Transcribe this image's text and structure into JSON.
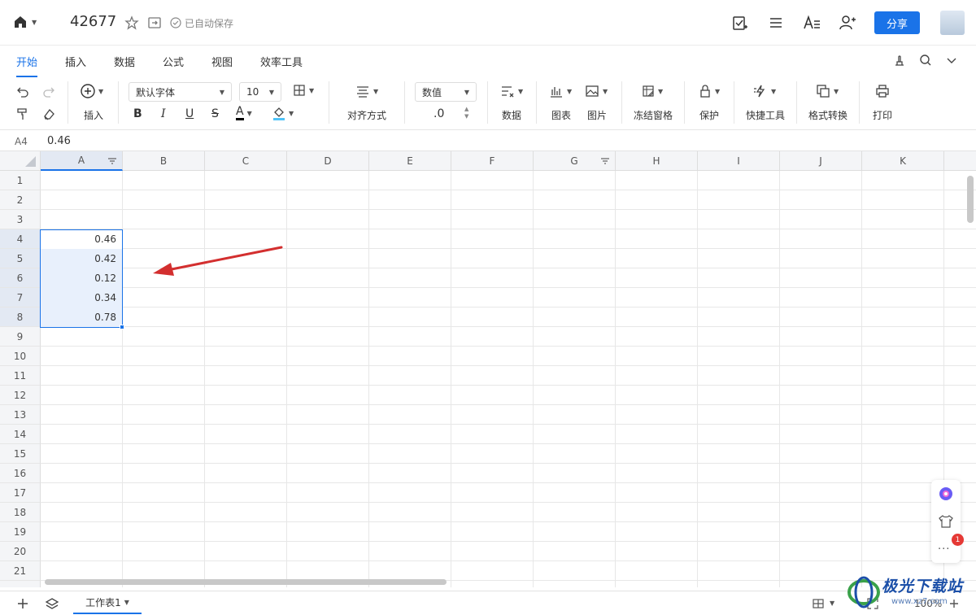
{
  "header": {
    "doc_title": "42677",
    "autosave_text": "已自动保存",
    "share_label": "分享"
  },
  "menu": {
    "tabs": [
      "开始",
      "插入",
      "数据",
      "公式",
      "视图",
      "效率工具"
    ],
    "active_tab": "开始"
  },
  "ribbon": {
    "insert_label": "插入",
    "font_name": "默认字体",
    "font_size": "10",
    "align_label": "对齐方式",
    "number_format": "数值",
    "decimal_text": ".0",
    "data_label": "数据",
    "chart_label": "图表",
    "picture_label": "图片",
    "freeze_label": "冻结窗格",
    "protect_label": "保护",
    "quicktools_label": "快捷工具",
    "convert_label": "格式转换",
    "print_label": "打印",
    "font_color": "#000000",
    "fill_color": "#4fc3f7"
  },
  "formula_bar": {
    "cell_ref": "A4",
    "content": "0.46"
  },
  "grid": {
    "columns": [
      "A",
      "B",
      "C",
      "D",
      "E",
      "F",
      "G",
      "H",
      "I",
      "J",
      "K"
    ],
    "rows": [
      "1",
      "2",
      "3",
      "4",
      "5",
      "6",
      "7",
      "8",
      "9",
      "10",
      "11",
      "12",
      "13",
      "14",
      "15",
      "16",
      "17",
      "18",
      "19",
      "20",
      "21"
    ],
    "selected_values": [
      "0.46",
      "0.42",
      "0.12",
      "0.34",
      "0.78"
    ]
  },
  "floating": {
    "badge_count": "1",
    "more_label": "···"
  },
  "bottom": {
    "sheet_name": "工作表1",
    "zoom_text": "100%"
  },
  "watermark": {
    "brand": "极光下载站",
    "url": "www.xz7.com"
  },
  "colors": {
    "accent": "#1a73e8",
    "annotation_arrow": "#d32f2f"
  }
}
